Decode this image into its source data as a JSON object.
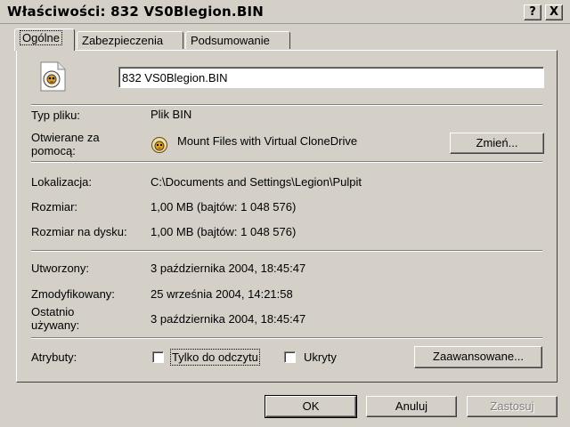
{
  "window": {
    "title": "Właściwości: 832 VS0Blegion.BIN",
    "help_button": "?",
    "close_button": "X"
  },
  "tabs": [
    {
      "label": "Ogólne"
    },
    {
      "label": "Zabezpieczenia"
    },
    {
      "label": "Podsumowanie"
    }
  ],
  "general": {
    "file_icon": "disc-image-file-icon",
    "file_name": "832 VS0Blegion.BIN",
    "type_label": "Typ pliku:",
    "type_value": "Plik BIN",
    "opens_with_label_line1": "Otwierane za",
    "opens_with_label_line2": "pomocą:",
    "opens_with_icon": "clonedrive-sheep-icon",
    "opens_with_value": "Mount Files with Virtual CloneDrive",
    "change_button": "Zmień...",
    "location_label": "Lokalizacja:",
    "location_value": "C:\\Documents and Settings\\Legion\\Pulpit",
    "size_label": "Rozmiar:",
    "size_value": "1,00 MB (bajtów: 1 048 576)",
    "size_on_disk_label": "Rozmiar na dysku:",
    "size_on_disk_value": "1,00 MB (bajtów: 1 048 576)",
    "created_label": "Utworzony:",
    "created_value": "3 października 2004, 18:45:47",
    "modified_label": "Zmodyfikowany:",
    "modified_value": "25 września 2004, 14:21:58",
    "accessed_label_line1": "Ostatnio",
    "accessed_label_line2": "używany:",
    "accessed_value": "3 października 2004, 18:45:47",
    "attributes_label": "Atrybuty:",
    "readonly_label": "Tylko do odczytu",
    "hidden_label": "Ukryty",
    "advanced_button": "Zaawansowane..."
  },
  "footer": {
    "ok_button": "OK",
    "cancel_button": "Anuluj",
    "apply_button": "Zastosuj"
  }
}
